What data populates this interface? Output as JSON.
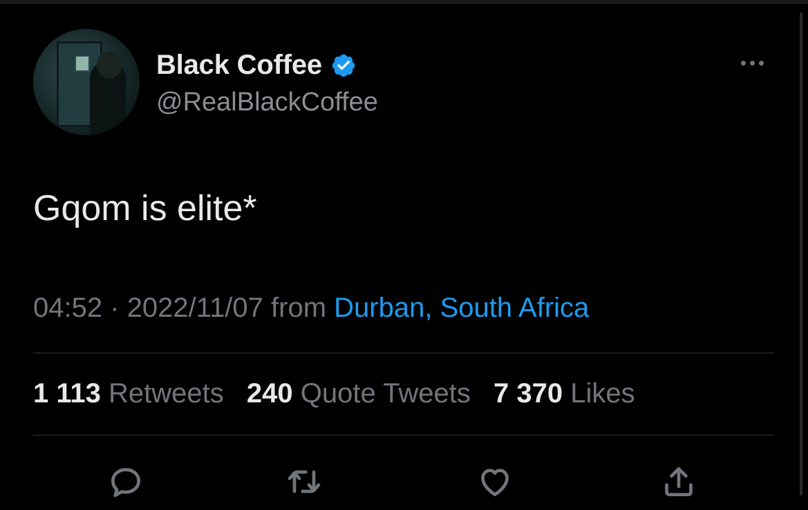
{
  "author": {
    "display_name": "Black Coffee",
    "handle": "@RealBlackCoffee",
    "verified": true,
    "verified_color": "#1d9bf0"
  },
  "tweet": {
    "text": "Gqom is elite*",
    "time": "04:52",
    "separator": "·",
    "date": "2022/11/07",
    "from_label": "from",
    "location": "Durban, South Africa"
  },
  "stats": {
    "retweets_count": "1 113",
    "retweets_label": "Retweets",
    "quotes_count": "240",
    "quotes_label": "Quote Tweets",
    "likes_count": "7 370",
    "likes_label": "Likes"
  },
  "actions": [
    {
      "name": "reply",
      "icon": "comment-icon"
    },
    {
      "name": "retweet",
      "icon": "retweet-icon"
    },
    {
      "name": "like",
      "icon": "heart-icon"
    },
    {
      "name": "share",
      "icon": "share-icon"
    }
  ],
  "colors": {
    "background": "#000000",
    "text_primary": "#e7e9ea",
    "text_secondary": "#71767b",
    "link": "#1d9bf0",
    "divider": "#2f3336"
  }
}
